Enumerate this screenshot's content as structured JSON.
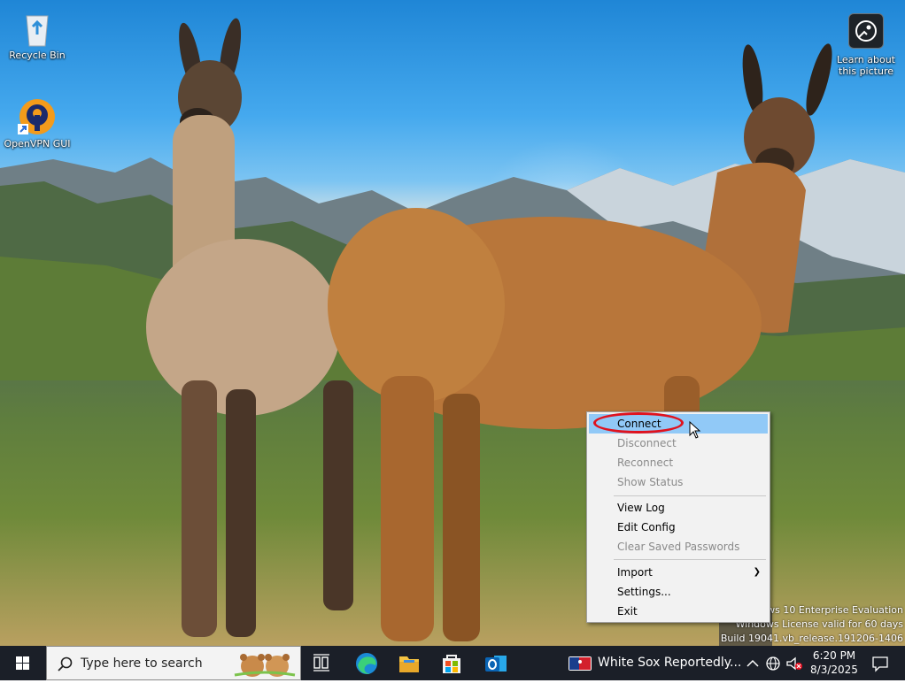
{
  "desktop": {
    "icons": [
      {
        "label": "Recycle Bin",
        "icon": "recycle-bin-icon"
      },
      {
        "label": "OpenVPN GUI",
        "icon": "openvpn-icon"
      }
    ],
    "learn_picture": {
      "line1": "Learn about",
      "line2": "this picture",
      "icon": "camera-info-icon"
    }
  },
  "context_menu": {
    "items": [
      {
        "label": "Connect",
        "state": "highlighted"
      },
      {
        "label": "Disconnect",
        "state": "disabled"
      },
      {
        "label": "Reconnect",
        "state": "disabled"
      },
      {
        "label": "Show Status",
        "state": "disabled"
      },
      {
        "label": "View Log",
        "state": "enabled"
      },
      {
        "label": "Edit Config",
        "state": "enabled"
      },
      {
        "label": "Clear Saved Passwords",
        "state": "disabled"
      },
      {
        "label": "Import",
        "state": "enabled",
        "submenu": true
      },
      {
        "label": "Settings...",
        "state": "enabled"
      },
      {
        "label": "Exit",
        "state": "enabled"
      }
    ],
    "highlight_color": "#91c9f7",
    "annotation_color": "#e0121e"
  },
  "watermark": {
    "line1": "Windows 10 Enterprise Evaluation",
    "line2": "Windows License valid for 60 days",
    "line3": "Build 19041.vb_release.191206-1406"
  },
  "taskbar": {
    "search_placeholder": "Type here to search",
    "news_text": "White Sox Reportedly...",
    "time": "6:20 PM",
    "date": "8/3/2025",
    "background": "#1b1f28"
  }
}
